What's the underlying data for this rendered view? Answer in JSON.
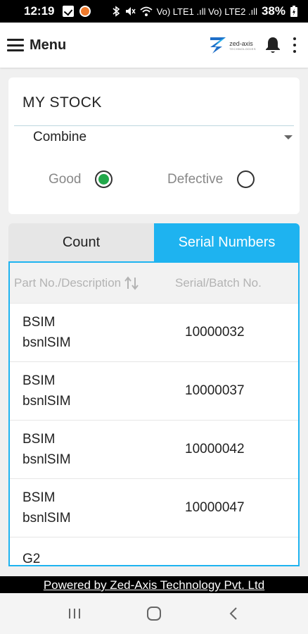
{
  "status_bar": {
    "time": "12:19",
    "network_text": "Vo) LTE1 .ıll Vo) LTE2 .ıll",
    "battery": "38%"
  },
  "header": {
    "menu_label": "Menu",
    "brand_name": "zed-axis",
    "brand_tagline": "TECHNOLOGIES"
  },
  "stock": {
    "title": "MY STOCK",
    "selected_filter": "Combine",
    "radio_good_label": "Good",
    "radio_defective_label": "Defective",
    "selected_radio": "Good"
  },
  "tabs": [
    {
      "label": "Count",
      "active": false
    },
    {
      "label": "Serial Numbers",
      "active": true
    }
  ],
  "table": {
    "columns": [
      "Part No./Description",
      "Serial/Batch No."
    ],
    "rows": [
      {
        "part": "BSIM",
        "description": "bsnlSIM",
        "serial": "10000032"
      },
      {
        "part": "BSIM",
        "description": "bsnlSIM",
        "serial": "10000037"
      },
      {
        "part": "BSIM",
        "description": "bsnlSIM",
        "serial": "10000042"
      },
      {
        "part": "BSIM",
        "description": "bsnlSIM",
        "serial": "10000047"
      },
      {
        "part": "G2",
        "description": "",
        "serial": ""
      }
    ]
  },
  "footer": {
    "text": "Powered by Zed-Axis Technology Pvt. Ltd"
  },
  "colors": {
    "accent": "#1eb3f0",
    "radio_selected": "#22a84a"
  }
}
